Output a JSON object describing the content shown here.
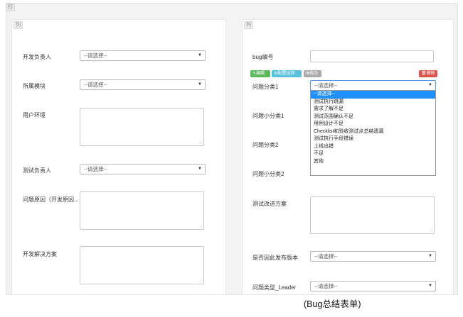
{
  "row_tag": "行",
  "col_tag": "列",
  "left": {
    "dev_owner_label": "开发负责人",
    "dev_owner_value": "--请选择--",
    "module_label": "所属模块",
    "module_value": "--请选择--",
    "user_env_label": "用户环境",
    "test_owner_label": "测试负责人",
    "test_owner_value": "--请选择--",
    "cause_label": "问题原因（开发原因...",
    "solution_label": "开发解决方案"
  },
  "right": {
    "bug_no_label": "bug编号",
    "buttons": {
      "edit": "编辑",
      "options": "配置选项",
      "move": "拖动",
      "delete": "删除"
    },
    "cat1_label": "问题分类1",
    "cat1_value": "--请选择--",
    "subcat1_label": "问题小分类1",
    "cat2_label": "问题分类2",
    "subcat2_label": "问题小分类2",
    "improve_label": "测试改进方案",
    "release_label": "是否因此发布版本",
    "release_value": "--请选择--",
    "leader_label": "问题类型_Leader",
    "leader_value": "--请选择--"
  },
  "dropdown_options": [
    "--请选择--",
    "测试执行跳漏",
    "需求了解不足",
    "测试范围确认不足",
    "用例设计不足",
    "Checklist和验收测试点总结遗漏",
    "测试执行手段错误",
    "上线出错",
    "不足",
    "其他"
  ],
  "caption": "(Bug总结表单)"
}
